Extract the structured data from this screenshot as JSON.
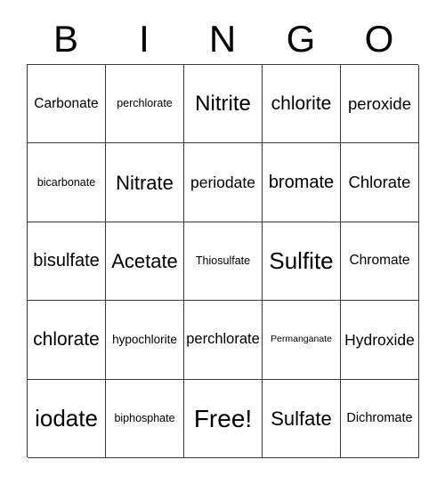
{
  "card": {
    "title_letters": [
      "B",
      "I",
      "N",
      "G",
      "O"
    ],
    "columns": 5,
    "rows": 5,
    "border_color": "#3a3a3a",
    "background_color": "#ffffff",
    "text_color": "#000000",
    "free_space": {
      "row": 4,
      "column": 2,
      "label": "Free!"
    },
    "grid": [
      [
        {
          "label": "Carbonate",
          "size": "s-15"
        },
        {
          "label": "perchlorate",
          "size": "s-12"
        },
        {
          "label": "Nitrite",
          "size": "s-24"
        },
        {
          "label": "chlorite",
          "size": "s-21"
        },
        {
          "label": "peroxide",
          "size": "s-18"
        }
      ],
      [
        {
          "label": "bicarbonate",
          "size": "s-12"
        },
        {
          "label": "Nitrate",
          "size": "s-22"
        },
        {
          "label": "periodate",
          "size": "s-17"
        },
        {
          "label": "bromate",
          "size": "s-20"
        },
        {
          "label": "Chlorate",
          "size": "s-18"
        }
      ],
      [
        {
          "label": "bisulfate",
          "size": "s-20"
        },
        {
          "label": "Acetate",
          "size": "s-22"
        },
        {
          "label": "Thiosulfate",
          "size": "s-12"
        },
        {
          "label": "Sulfite",
          "size": "s-26"
        },
        {
          "label": "Chromate",
          "size": "s-15"
        }
      ],
      [
        {
          "label": "chlorate",
          "size": "s-21"
        },
        {
          "label": "hypochlorite",
          "size": "s-13"
        },
        {
          "label": "perchlorate",
          "size": "s-16"
        },
        {
          "label": "Permanganate",
          "size": "s-10"
        },
        {
          "label": "Hydroxide",
          "size": "s-17"
        }
      ],
      [
        {
          "label": "iodate",
          "size": "s-26"
        },
        {
          "label": "biphosphate",
          "size": "s-12"
        },
        {
          "label": "Free!",
          "size": "s-28"
        },
        {
          "label": "Sulfate",
          "size": "s-22"
        },
        {
          "label": "Dichromate",
          "size": "s-14"
        }
      ]
    ]
  }
}
